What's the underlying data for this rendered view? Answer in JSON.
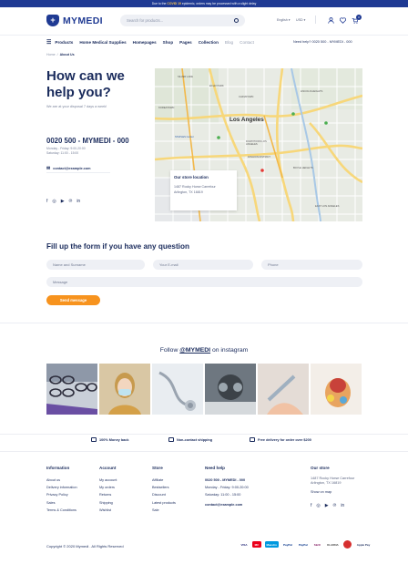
{
  "topbar": {
    "pre": "Due to the",
    "highlight": "COVID 19",
    "post": "epidemic, orders may be processed with a slight delay"
  },
  "header": {
    "logo": "MYMEDI",
    "search_placeholder": "Search for products...",
    "language": "English",
    "currency": "USD",
    "cart_count": "0"
  },
  "nav": {
    "products": "Products",
    "items": [
      "Home Medical Supplies",
      "Homepages",
      "Shop",
      "Pages",
      "Collection",
      "Blog",
      "Contact"
    ],
    "need_help": "Need help? 0020 500 - MYMEDI - 000"
  },
  "breadcrumb": {
    "home": "Home",
    "sep": "/",
    "current": "About Us"
  },
  "contact": {
    "title": "How can we help you?",
    "subtitle": "We are at your disposal 7 days a week!",
    "phone": "0020 500 - MYMEDI - 000",
    "hours1": "Monday - Friday: 9:00-20:00",
    "hours2": "Saturday: 11:00 - 15:00",
    "email": "contact@example.com"
  },
  "map": {
    "store_title": "Our store location",
    "addr1": "1487 Rocky Horse Carrefour",
    "addr2": "Arlington, TX 16819",
    "city": "Los Angeles",
    "labels": [
      "DOWNTOWN LOS ANGELES",
      "FASHION DISTRICT",
      "CHINATOWN",
      "STAPLES Center",
      "SILVER LAKE",
      "ECHO PARK",
      "BOYLE HEIGHTS",
      "KOREATOWN",
      "LINCOLN HEIGHTS",
      "EAST LOS ANGELES"
    ]
  },
  "form": {
    "title": "Fill up the form if you have any question",
    "name": "Name and Surname",
    "email": "Your E-mail",
    "phone": "Phone",
    "message": "Message",
    "send": "Send message"
  },
  "instagram": {
    "pre": "Follow",
    "handle": "@MYMEDI",
    "post": "on instagram"
  },
  "features": [
    "100% Money back",
    "Non-contact shipping",
    "Free delivery for order over $200"
  ],
  "footer": {
    "information": {
      "title": "Information",
      "items": [
        "About us",
        "Delivery information",
        "Privacy Policy",
        "Sales",
        "Terms & Conditions"
      ]
    },
    "account": {
      "title": "Account",
      "items": [
        "My account",
        "My orders",
        "Returns",
        "Shipping",
        "Wishlist"
      ]
    },
    "store": {
      "title": "Store",
      "items": [
        "Affiliate",
        "Bestsellers",
        "Discount",
        "Latest products",
        "Sale"
      ]
    },
    "needhelp": {
      "title": "Need help",
      "phone": "0020 500 - MYMEDI - 000",
      "h1": "Monday - Friday: 9:00-20:00",
      "h2": "Saturday: 11:00 - 15:00",
      "email": "contact@example.com"
    },
    "ourstore": {
      "title": "Our store",
      "addr1": "1487 Rocky Horse Carrefour",
      "addr2": "Arlington, TX 16819",
      "link": "Show on map"
    },
    "copyright": "Copyright © 2020 Mymedi . All Rights Reserved",
    "payments": [
      "VISA",
      "MC",
      "Maestro",
      "PayPal",
      "PayPal",
      "Skrill",
      "KLARNA",
      "",
      "Apple Pay"
    ]
  },
  "colors": {
    "brand": "#1f3a93",
    "accent": "#f7931e",
    "highlight": "#ffc94d"
  }
}
